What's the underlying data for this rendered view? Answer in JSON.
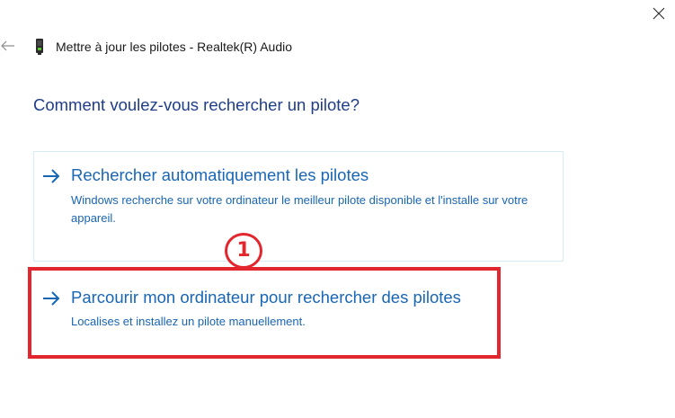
{
  "window": {
    "title": "Mettre à jour les pilotes - Realtek(R) Audio"
  },
  "heading": "Comment voulez-vous rechercher un pilote?",
  "options": [
    {
      "title": "Rechercher automatiquement les pilotes",
      "description": "Windows recherche sur votre ordinateur le meilleur pilote disponible et l'installe sur votre appareil."
    },
    {
      "title": "Parcourir mon ordinateur pour rechercher des pilotes",
      "description": "Localises et installez un pilote manuellement."
    }
  ],
  "annotation": {
    "step_number": "1",
    "color": "#e3262e"
  },
  "icons": {
    "close": "close-icon",
    "back": "back-arrow-icon",
    "device": "audio-device-icon",
    "option_arrow": "arrow-right-icon"
  },
  "colors": {
    "link": "#1866b4",
    "heading": "#1e3d8a",
    "option_border": "#d7ecf5",
    "highlight": "#e3262e"
  }
}
